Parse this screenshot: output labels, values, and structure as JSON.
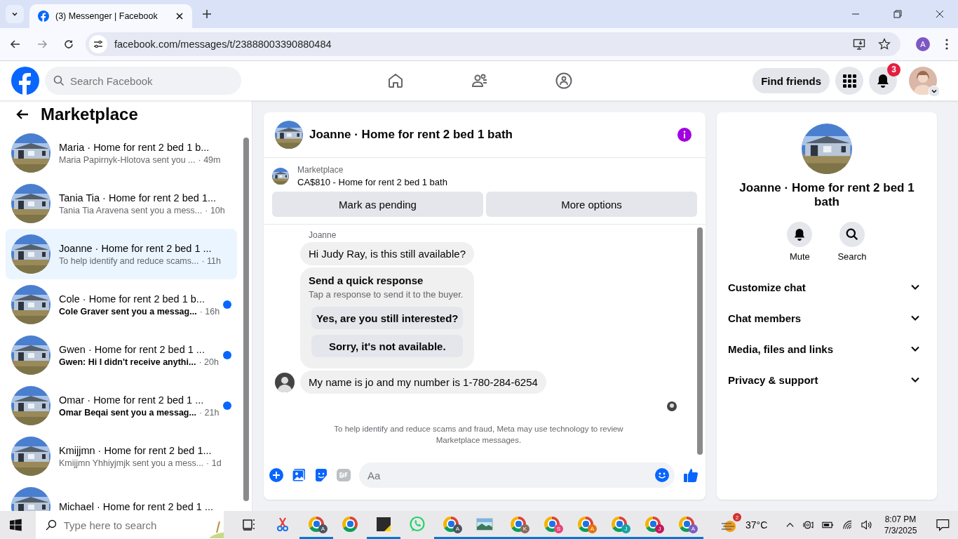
{
  "browser": {
    "tab_title": "(3) Messenger | Facebook",
    "url": "facebook.com/messages/t/23888003390880484",
    "profile_initial": "A"
  },
  "header": {
    "search_placeholder": "Search Facebook",
    "find_friends": "Find friends",
    "notification_count": "3"
  },
  "sidebar": {
    "title": "Marketplace",
    "conversations": [
      {
        "title": "Maria · Home for rent 2 bed 1 b...",
        "preview": "Maria Papirnyk-Hlotova sent you ...",
        "time": "· 49m",
        "unread": false,
        "selected": false
      },
      {
        "title": "Tania Tia · Home for rent 2 bed 1...",
        "preview": "Tania Tia Aravena sent you a mess...",
        "time": "· 10h",
        "unread": false,
        "selected": false
      },
      {
        "title": "Joanne · Home for rent 2 bed 1 ...",
        "preview": "To help identify and reduce scams...",
        "time": "· 11h",
        "unread": false,
        "selected": true
      },
      {
        "title": "Cole · Home for rent 2 bed 1 b...",
        "preview": "Cole Graver sent you a messag...",
        "time": "· 16h",
        "unread": true,
        "selected": false
      },
      {
        "title": "Gwen · Home for rent 2 bed 1 ...",
        "preview": "Gwen: Hi I didn't receive anythi...",
        "time": "· 20h",
        "unread": true,
        "selected": false
      },
      {
        "title": "Omar · Home for rent 2 bed 1 ...",
        "preview": "Omar Beqai sent you a messag...",
        "time": "· 21h",
        "unread": true,
        "selected": false
      },
      {
        "title": "Kmijjmn · Home for rent 2 bed 1...",
        "preview": "Kmijjmn Yhhiyjmjk sent you a mess...",
        "time": "· 1d",
        "unread": false,
        "selected": false
      },
      {
        "title": "Michael · Home for rent 2 bed 1 ...",
        "selected": false
      }
    ]
  },
  "chat": {
    "title": "Joanne · Home for rent 2 bed 1 bath",
    "listing_label": "Marketplace",
    "listing": "CA$810 - Home for rent 2 bed 1 bath",
    "listing_buttons": [
      "Mark as pending",
      "More options"
    ],
    "messages": [
      {
        "kind": "sender",
        "text": "Joanne"
      },
      {
        "kind": "bubble",
        "text": "Hi Judy Ray, is this still available?"
      },
      {
        "kind": "quick",
        "title": "Send a quick response",
        "subtitle": "Tap a response to send it to the buyer.",
        "options": [
          "Yes, are you still interested?",
          "Sorry, it's not available."
        ]
      },
      {
        "kind": "bubble_avatar",
        "text": "My name is jo and my number is 1-780-284-6254"
      },
      {
        "kind": "seen"
      },
      {
        "kind": "notice",
        "text": "To help identify and reduce scams and fraud, Meta may use technology to review Marketplace messages."
      }
    ],
    "composer_placeholder": "Aa"
  },
  "details": {
    "title": "Joanne · Home for rent 2 bed 1 bath",
    "actions": [
      {
        "kind": "mute",
        "label": "Mute"
      },
      {
        "kind": "search",
        "label": "Search"
      }
    ],
    "sections": [
      {
        "label": "Customize chat",
        "expanded": false
      },
      {
        "label": "Chat members",
        "expanded": false
      },
      {
        "label": "Media, files and links",
        "expanded": false
      },
      {
        "label": "Privacy & support",
        "expanded": false
      }
    ]
  },
  "taskbar": {
    "search_placeholder": "Type here to search",
    "apps": [
      {
        "kind": "taskview",
        "running": false
      },
      {
        "kind": "snip",
        "running": false
      },
      {
        "kind": "chrome",
        "badge": "A",
        "color": "#4a5560",
        "running": true
      },
      {
        "kind": "chrome",
        "running": false
      },
      {
        "kind": "sticky",
        "running": true
      },
      {
        "kind": "whatsapp",
        "running": false
      },
      {
        "kind": "chrome",
        "badge": "A",
        "color": "#4a5560",
        "running": true
      },
      {
        "kind": "photos",
        "running": true
      },
      {
        "kind": "chrome",
        "badge": "K",
        "color": "#8a6a5a",
        "running": true
      },
      {
        "kind": "chrome",
        "badge": "S",
        "color": "#e8437a",
        "running": true
      },
      {
        "kind": "chrome",
        "badge": "A",
        "color": "#e8710a",
        "running": true
      },
      {
        "kind": "chrome",
        "badge": "J",
        "color": "#12a4a4",
        "running": true
      },
      {
        "kind": "chrome",
        "badge": "J",
        "color": "#c2185b",
        "running": true
      },
      {
        "kind": "chrome",
        "badge": "A",
        "color": "#7b5cc4",
        "running": true
      }
    ],
    "weather_badge": "2",
    "temperature": "37°C",
    "time": "8:07 PM",
    "date": "7/3/2025"
  }
}
